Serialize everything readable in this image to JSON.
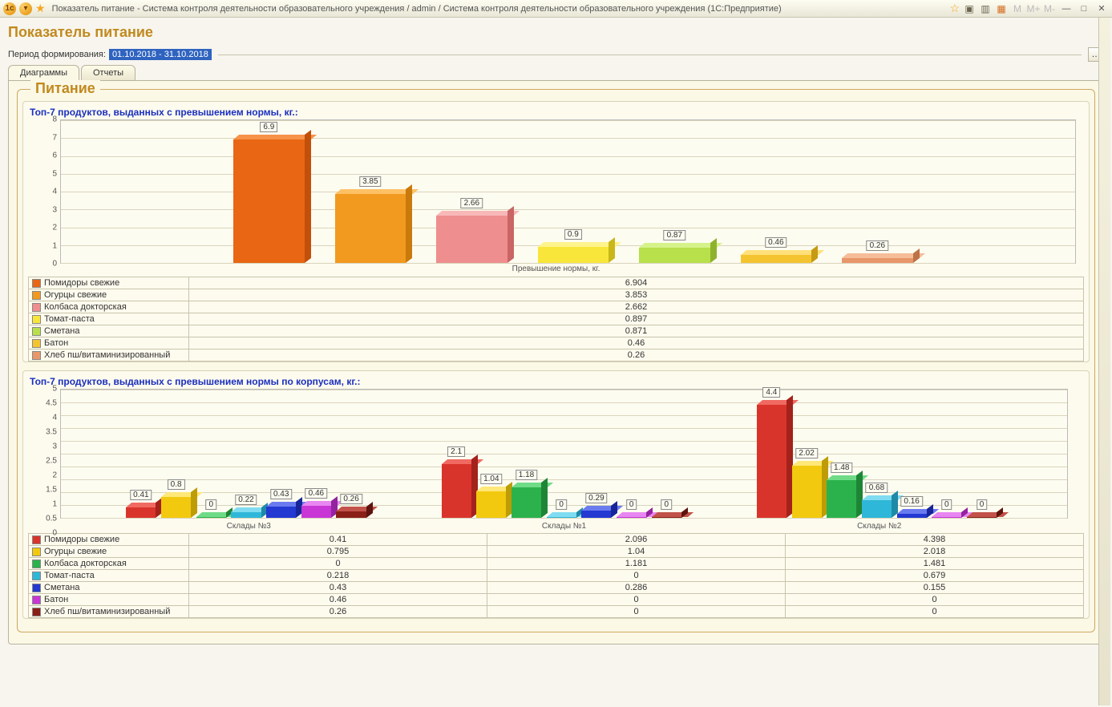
{
  "titlebar": {
    "text": "Показатель питание - Система контроля деятельности образовательного учреждения / admin / Система контроля деятельности образовательного учреждения  (1С:Предприятие)"
  },
  "page_title": "Показатель питание",
  "period": {
    "label": "Период формирования:",
    "value": "01.10.2018 - 31.10.2018",
    "button": "…"
  },
  "tabs": {
    "diagrams": "Диаграммы",
    "reports": "Отчеты"
  },
  "fieldset_title": "Питание",
  "colors": {
    "c1": [
      "#e86614",
      "#f7924a",
      "#c2500a"
    ],
    "c2": [
      "#f29a1f",
      "#ffc165",
      "#c97a0c"
    ],
    "c3": [
      "#ef8e8e",
      "#f8b8b8",
      "#c96565"
    ],
    "c4": [
      "#f8e63a",
      "#fff38d",
      "#c9b71a"
    ],
    "c5": [
      "#b7e04b",
      "#d6f28a",
      "#8fb22e"
    ],
    "c6": [
      "#f4c430",
      "#ffe07a",
      "#c79a14"
    ],
    "c7": [
      "#e7976a",
      "#f6bd99",
      "#bd7347"
    ],
    "b1": [
      "#d9342b",
      "#f06a62",
      "#a3221b"
    ],
    "b2": [
      "#f2c90e",
      "#ffe778",
      "#bd9c06"
    ],
    "b3": [
      "#2bb24c",
      "#6fdb87",
      "#1e8537"
    ],
    "b4": [
      "#2fb7d9",
      "#7fdcf1",
      "#1e8aa7"
    ],
    "b5": [
      "#2339d1",
      "#6a7bf0",
      "#17259a"
    ],
    "b6": [
      "#c836d6",
      "#e887f1",
      "#9423a0"
    ],
    "b7": [
      "#8a1f17",
      "#c2534a",
      "#5d130e"
    ]
  },
  "chart_data": [
    {
      "type": "bar",
      "title": "Топ-7 продуктов, выданных с превышением нормы, кг.:",
      "xlabel": "Превышение нормы, кг.",
      "ylim": [
        0,
        8
      ],
      "ystep": 1,
      "categories": [
        "Помидоры свежие",
        "Огурцы свежие",
        "Колбаса докторская",
        "Томат-паста",
        "Сметана",
        "Батон",
        "Хлеб пш/витаминизированный"
      ],
      "values": [
        6.9,
        3.85,
        2.66,
        0.9,
        0.87,
        0.46,
        0.26
      ],
      "table_values": [
        6.904,
        3.853,
        2.662,
        0.897,
        0.871,
        0.46,
        0.26
      ],
      "color_keys": [
        "c1",
        "c2",
        "c3",
        "c4",
        "c5",
        "c6",
        "c7"
      ]
    },
    {
      "type": "bar-grouped",
      "title": "Топ-7 продуктов, выданных с превышением нормы по корпусам, кг.:",
      "ylim": [
        0,
        5
      ],
      "ystep": 0.5,
      "groups": [
        "Склады №3",
        "Склады №1",
        "Склады №2"
      ],
      "series": [
        {
          "name": "Помидоры свежие",
          "color_key": "b1",
          "labels": [
            0.41,
            2.1,
            4.4
          ],
          "values": [
            0.41,
            2.096,
            4.398
          ]
        },
        {
          "name": "Огурцы свежие",
          "color_key": "b2",
          "labels": [
            0.8,
            1.04,
            2.02
          ],
          "values": [
            0.795,
            1.04,
            2.018
          ]
        },
        {
          "name": "Колбаса докторская",
          "color_key": "b3",
          "labels": [
            0,
            1.18,
            1.48
          ],
          "values": [
            0,
            1.181,
            1.481
          ]
        },
        {
          "name": "Томат-паста",
          "color_key": "b4",
          "labels": [
            0.22,
            0,
            0.68
          ],
          "values": [
            0.218,
            0,
            0.679
          ]
        },
        {
          "name": "Сметана",
          "color_key": "b5",
          "labels": [
            0.43,
            0.29,
            0.16
          ],
          "values": [
            0.43,
            0.286,
            0.155
          ]
        },
        {
          "name": "Батон",
          "color_key": "b6",
          "labels": [
            0.46,
            0,
            0
          ],
          "values": [
            0.46,
            0,
            0
          ]
        },
        {
          "name": "Хлеб пш/витаминизированный",
          "color_key": "b7",
          "labels": [
            0.26,
            0,
            0
          ],
          "values": [
            0.26,
            0,
            0
          ]
        }
      ]
    }
  ]
}
